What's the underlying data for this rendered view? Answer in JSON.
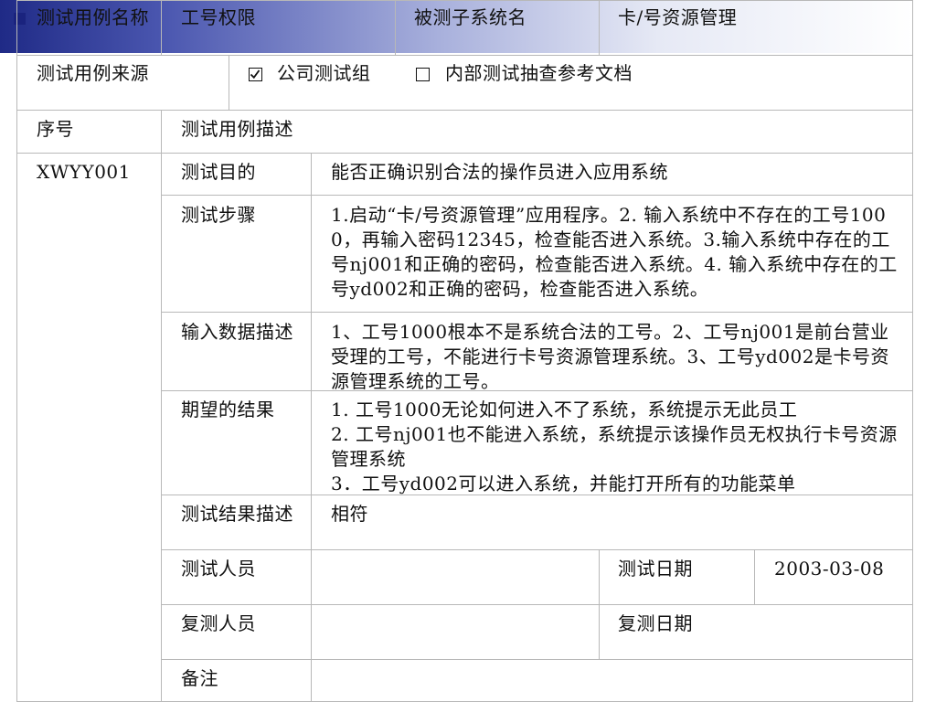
{
  "header_row": {
    "case_name_label": "测试用例名称",
    "case_name_value": "工号权限",
    "subsystem_label": "被测子系统名",
    "subsystem_value": "卡/号资源管理"
  },
  "source_row": {
    "label": "测试用例来源",
    "options": [
      {
        "label": "公司测试组",
        "checked": true
      },
      {
        "label": "内部测试抽查参考文档",
        "checked": false
      }
    ]
  },
  "columns": {
    "seq": "序号",
    "description": "测试用例描述"
  },
  "case": {
    "id": "XWYY001",
    "purpose_label": "测试目的",
    "purpose": "能否正确识别合法的操作员进入应用系统",
    "steps_label": "测试步骤",
    "steps": "1.启动“卡/号资源管理”应用程序。2. 输入系统中不存在的工号1000，再输入密码12345，检查能否进入系统。3.输入系统中存在的工号nj001和正确的密码，检查能否进入系统。4. 输入系统中存在的工号yd002和正确的密码，检查能否进入系统。",
    "input_label": "输入数据描述",
    "input": "1、工号1000根本不是系统合法的工号。2、工号nj001是前台营业受理的工号，不能进行卡号资源管理系统。3、工号yd002是卡号资源管理系统的工号。",
    "expected_label": "期望的结果",
    "expected": [
      "1. 工号1000无论如何进入不了系统，系统提示无此员工",
      "2. 工号nj001也不能进入系统，系统提示该操作员无权执行卡号资源管理系统",
      "3．工号yd002可以进入系统，并能打开所有的功能菜单"
    ],
    "result_label": "测试结果描述",
    "result": "相符",
    "tester_label": "测试人员",
    "tester": "",
    "test_date_label": "测试日期",
    "test_date": "2003-03-08",
    "retester_label": "复测人员",
    "retester": "",
    "retest_date_label": "复测日期",
    "retest_date": "",
    "remarks_label": "备注",
    "remarks": ""
  }
}
